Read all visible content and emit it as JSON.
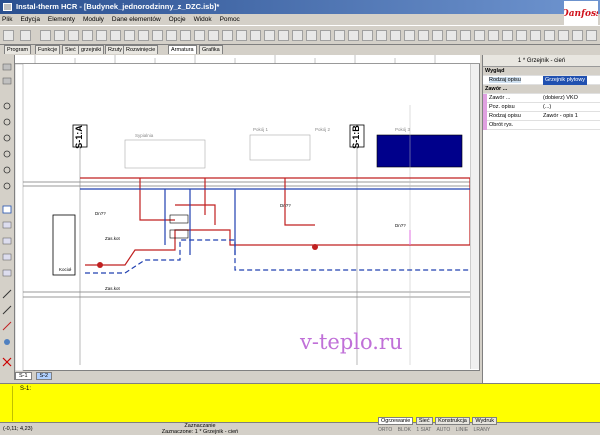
{
  "window": {
    "title": "Instal-therm HCR - [Budynek_jednorodzinny_z_DZC.isb]*"
  },
  "menu": [
    "Plik",
    "Edycja",
    "Elementy",
    "Moduły",
    "Dane elementów",
    "Opcje",
    "Widok",
    "Pomoc"
  ],
  "tabs": [
    "Program",
    "Funkcje",
    "Sieć",
    "grzejniki",
    "Rzuty",
    "Rozwinięcie",
    "Armatura",
    "Grafika"
  ],
  "tabs_active": "Armatura",
  "properties": {
    "header": "1 * Grzejnik - cień",
    "section_wyglad": "Wygląd",
    "rodzaj_opisu_key": "Rodzaj opisu",
    "rodzaj_opisu_val": "Grzejnik płytowy",
    "section_zawor": "Zawór ...",
    "rows": [
      {
        "key": "Zawór ...",
        "val": "(dobierz) VKO"
      },
      {
        "key": "Poz. opisu",
        "val": "(...)"
      },
      {
        "key": "Rodzaj opisu",
        "val": "Zawór - opis 1"
      },
      {
        "key": "Obrót rys.",
        "val": ""
      }
    ]
  },
  "drawing": {
    "riser_a": "S-1:A",
    "riser_b": "S-1:B",
    "radiator_labels": [
      "Sypialnia",
      "Pokój 1",
      "Pokój 2",
      "Pokój 3"
    ],
    "pipe_label_1": "Dn??",
    "zasilanie": "Zas.kot",
    "zasilanie_2": "Zas.kot",
    "boiler": "Kocioł",
    "watermark": "v-teplo.ru"
  },
  "sheets": [
    "S-1",
    "S-2"
  ],
  "sheets_active": "S-2",
  "output": {
    "text": "S-1:"
  },
  "status": {
    "coords": "(-0,11; 4,23)",
    "selection_label": "Zaznaczanie",
    "selection_value": "Zaznaczone: 1 * Grzejnik - cień"
  },
  "bottom_tabs": [
    "Ogrzewanie",
    "Sieć",
    "Konstrukcja",
    "Wydruk"
  ],
  "bottom_tabs_active": "Ogrzewanie",
  "modes": [
    "ORTO",
    "BLOK",
    "1 SIAT",
    "AUTO",
    "LINIE",
    "LRANY"
  ]
}
